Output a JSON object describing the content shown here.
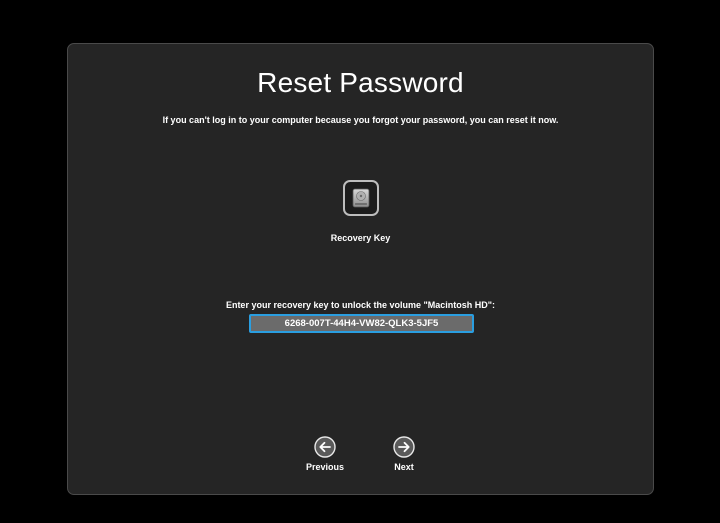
{
  "dialog": {
    "title": "Reset Password",
    "subtitle": "If you can't log in to your computer because you forgot your password, you can reset it now."
  },
  "recovery": {
    "icon": "disk-drive-icon",
    "label": "Recovery Key",
    "prompt": "Enter your recovery key to unlock the volume \"Macintosh HD\":",
    "key_value": "6268-007T-44H4-VW82-QLK3-5JF5"
  },
  "navigation": {
    "previous_label": "Previous",
    "previous_icon": "arrow-left-icon",
    "next_label": "Next",
    "next_icon": "arrow-right-icon"
  },
  "colors": {
    "background": "#000000",
    "panel": "#252525",
    "focus_ring": "#2a9ee0",
    "input_fill": "#6b6b6b"
  }
}
